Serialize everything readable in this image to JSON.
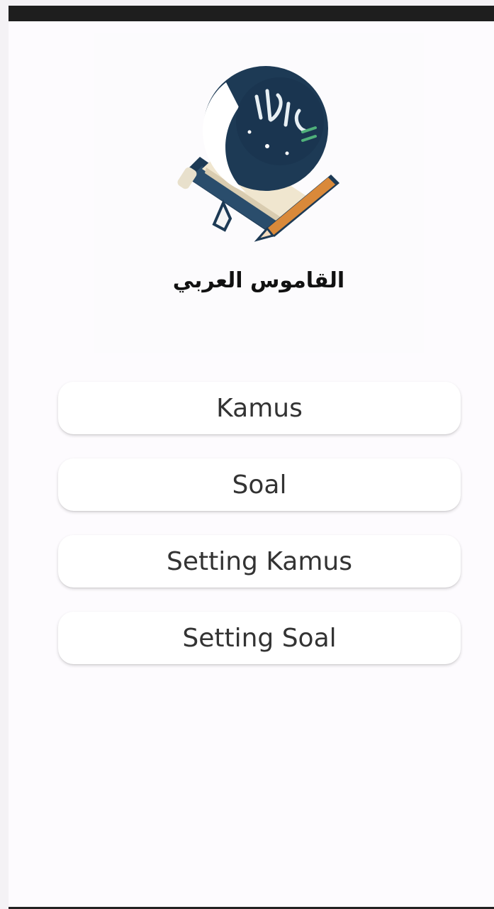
{
  "app": {
    "logo_title": "القاموس العربي",
    "logo_calligraphy": "الترجمة"
  },
  "menu": {
    "buttons": [
      {
        "label": "Kamus"
      },
      {
        "label": "Soal"
      },
      {
        "label": "Setting Kamus"
      },
      {
        "label": "Setting Soal"
      }
    ]
  },
  "colors": {
    "status_bar": "#1e1e1e",
    "background": "#fdfbfe",
    "logo_navy": "#1d3a55",
    "button_bg": "#ffffff",
    "button_text": "#333333"
  }
}
